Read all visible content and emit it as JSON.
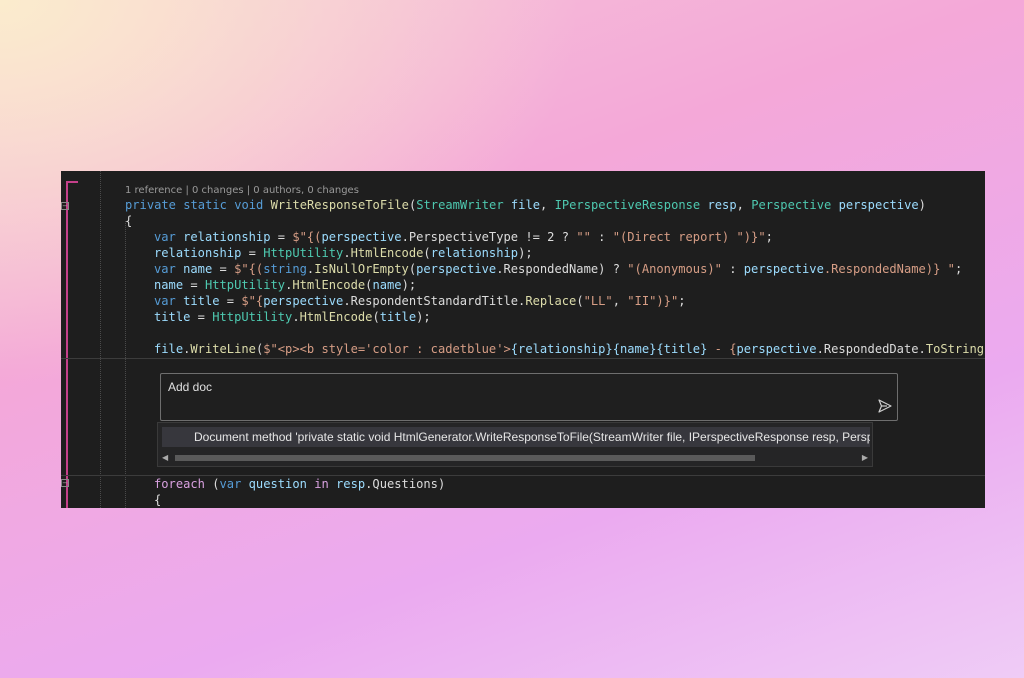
{
  "editor": {
    "codelens": "1 reference | 0 changes | 0 authors, 0 changes",
    "lines": {
      "sig": {
        "t1": "private",
        "t2": " ",
        "t3": "static",
        "t4": " ",
        "t5": "void",
        "t6": " ",
        "t7": "WriteResponseToFile",
        "t8": "(",
        "t9": "StreamWriter",
        "t10": " ",
        "t11": "file",
        "t12": ", ",
        "t13": "IPerspectiveResponse",
        "t14": " ",
        "t15": "resp",
        "t16": ", ",
        "t17": "Perspective",
        "t18": " ",
        "t19": "perspective",
        "t20": ")"
      },
      "open1": "{",
      "l1": {
        "a": "var",
        "b": " ",
        "c": "relationship",
        "d": " = ",
        "e": "$\"{(",
        "f": "perspective",
        "g": ".PerspectiveType != 2 ? ",
        "h": "\"\"",
        "i": " : ",
        "j": "\"(Direct report) \"",
        "k": ")}\"",
        "l": ";"
      },
      "l2": {
        "a": "relationship",
        "b": " = ",
        "c": "HttpUtility",
        "d": ".",
        "e": "HtmlEncode",
        "f": "(",
        "g": "relationship",
        "h": ");"
      },
      "l3": {
        "a": "var",
        "b": " ",
        "c": "name",
        "d": " = ",
        "e": "$\"{(",
        "f": "string",
        "g": ".",
        "h": "IsNullOrEmpty",
        "i": "(",
        "j": "perspective",
        "k": ".RespondedName) ? ",
        "l": "\"(Anonymous)\"",
        "m": " : ",
        "n": "perspective",
        "o": ".RespondedName)} \"",
        "p": ";"
      },
      "l4": {
        "a": "name",
        "b": " = ",
        "c": "HttpUtility",
        "d": ".",
        "e": "HtmlEncode",
        "f": "(",
        "g": "name",
        "h": ");"
      },
      "l5": {
        "a": "var",
        "b": " ",
        "c": "title",
        "d": " = ",
        "e": "$\"{",
        "f": "perspective",
        "g": ".RespondentStandardTitle.",
        "h": "Replace",
        "i": "(",
        "j": "\"LL\"",
        "k": ", ",
        "l": "\"II\"",
        "m": ")}\"",
        "n": ";"
      },
      "l6": {
        "a": "title",
        "b": " = ",
        "c": "HttpUtility",
        "d": ".",
        "e": "HtmlEncode",
        "f": "(",
        "g": "title",
        "h": ");"
      },
      "l7": {
        "a": "file",
        "b": ".",
        "c": "WriteLine",
        "d": "(",
        "e": "$\"<p><b style='color : cadetblue'>",
        "f": "{relationship}",
        "g": "{name}",
        "h": "{title}",
        "i": " - {",
        "j": "perspective",
        "k": ".RespondedDate.",
        "l": "ToString",
        "m": "(\""
      },
      "l8": {
        "a": "foreach",
        "b": " (",
        "c": "var",
        "d": " ",
        "e": "question",
        "f": " ",
        "g": "in",
        "h": " ",
        "i": "resp",
        "j": ".Questions)"
      },
      "open2": "{"
    }
  },
  "chat": {
    "input_label": "Add doc",
    "send_icon": "send-icon"
  },
  "suggestion": {
    "text": "Document method 'private static void HtmlGenerator.WriteResponseToFile(StreamWriter file, IPerspectiveResponse resp, Persp"
  }
}
